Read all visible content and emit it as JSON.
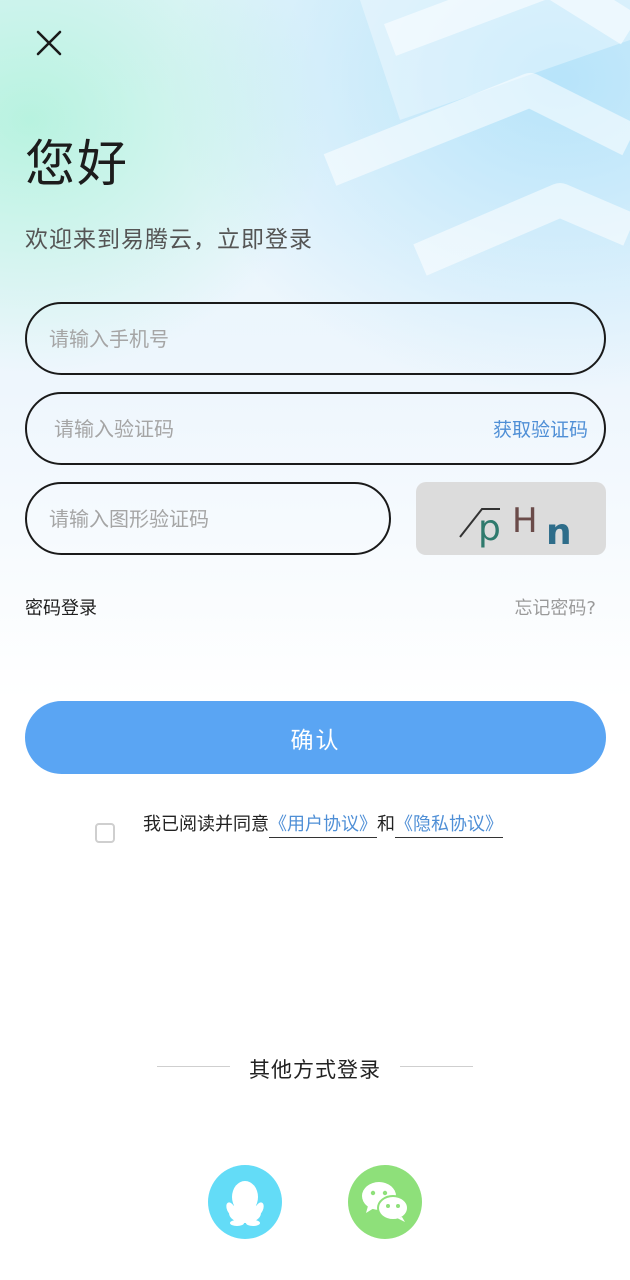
{
  "header": {
    "close_icon": "close-icon"
  },
  "greeting": {
    "title": "您好",
    "subtitle": "欢迎来到易腾云，立即登录"
  },
  "form": {
    "phone_placeholder": "请输入手机号",
    "sms_placeholder": "请输入验证码",
    "get_code_label": "获取验证码",
    "image_code_placeholder": "请输入图形验证码",
    "captcha_text": "pHn"
  },
  "links": {
    "password_login": "密码登录",
    "forgot_password": "忘记密码?"
  },
  "confirm_label": "确认",
  "agreement": {
    "checked": false,
    "prefix": "我已阅读并同意",
    "user_agreement": "《用户协议》",
    "conjunction": "和",
    "privacy_policy": "《隐私协议》"
  },
  "other_login": {
    "label": "其他方式登录",
    "providers": [
      {
        "name": "qq-icon",
        "color": "#63dcf7"
      },
      {
        "name": "wechat-icon",
        "color": "#8ee07a"
      }
    ]
  },
  "colors": {
    "accent": "#5aa5f3",
    "link": "#4f8fd6",
    "text": "#1c1c1c"
  }
}
